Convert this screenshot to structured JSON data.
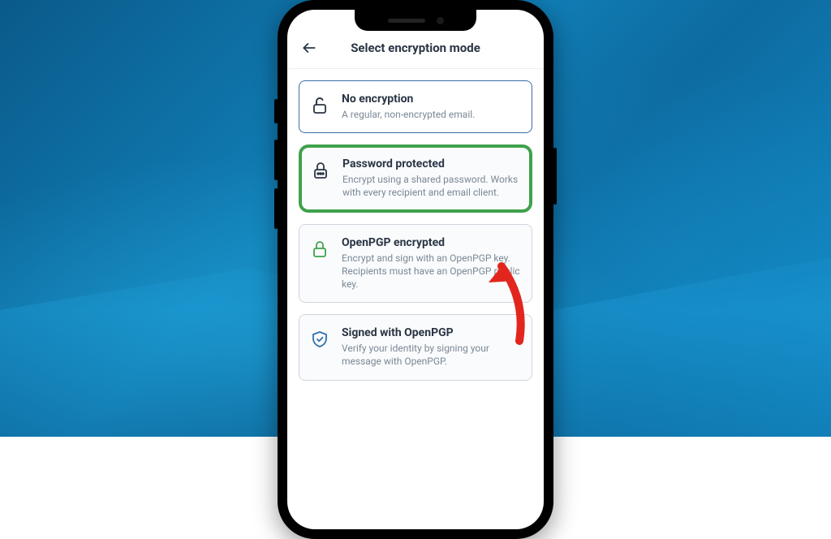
{
  "header": {
    "title": "Select encryption mode"
  },
  "options": [
    {
      "title": "No encryption",
      "desc": "A regular, non-encrypted email."
    },
    {
      "title": "Password protected",
      "desc": "Encrypt using a shared password. Works with every recipient and email client."
    },
    {
      "title": "OpenPGP encrypted",
      "desc": "Encrypt and sign with an OpenPGP key. Recipients must have an OpenPGP public key."
    },
    {
      "title": "Signed with OpenPGP",
      "desc": "Verify your identity by signing your message with OpenPGP."
    }
  ]
}
